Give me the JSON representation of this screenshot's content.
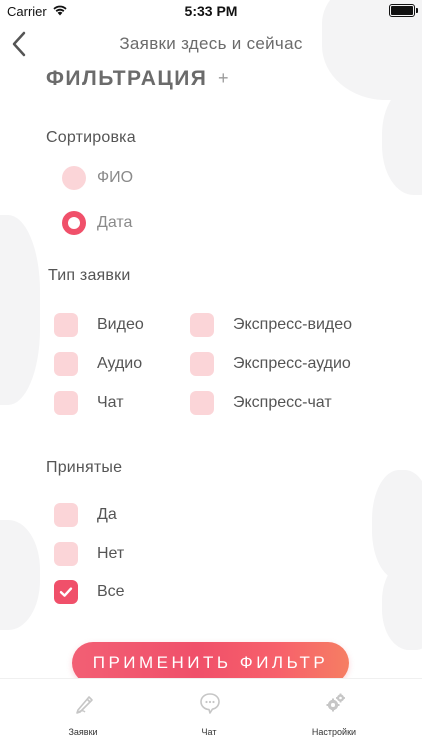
{
  "status_bar": {
    "carrier": "Carrier",
    "time": "5:33 PM"
  },
  "nav": {
    "title": "Заявки здесь и сейчас"
  },
  "filter": {
    "header": "ФИЛЬТРАЦИЯ",
    "add_symbol": "+"
  },
  "sorting": {
    "title": "Сортировка",
    "options": [
      {
        "label": "ФИО",
        "selected": false
      },
      {
        "label": "Дата",
        "selected": true
      }
    ]
  },
  "request_type": {
    "title": "Тип заявки",
    "options": [
      {
        "label": "Видео",
        "checked": false
      },
      {
        "label": "Аудио",
        "checked": false
      },
      {
        "label": "Чат",
        "checked": false
      },
      {
        "label": "Экспресс-видео",
        "checked": false
      },
      {
        "label": "Экспресс-аудио",
        "checked": false
      },
      {
        "label": "Экспресс-чат",
        "checked": false
      }
    ]
  },
  "accepted": {
    "title": "Принятые",
    "options": [
      {
        "label": "Да",
        "checked": false
      },
      {
        "label": "Нет",
        "checked": false
      },
      {
        "label": "Все",
        "checked": true
      }
    ]
  },
  "apply_button": {
    "label": "ПРИМЕНИТЬ ФИЛЬТР"
  },
  "tabs": [
    {
      "label": "Заявки",
      "icon": "pen-icon"
    },
    {
      "label": "Чат",
      "icon": "chat-bubble-icon"
    },
    {
      "label": "Настройки",
      "icon": "gears-icon"
    }
  ],
  "colors": {
    "accent": "#f0506a",
    "control_inactive": "#fbd5d8",
    "text": "#555555"
  }
}
